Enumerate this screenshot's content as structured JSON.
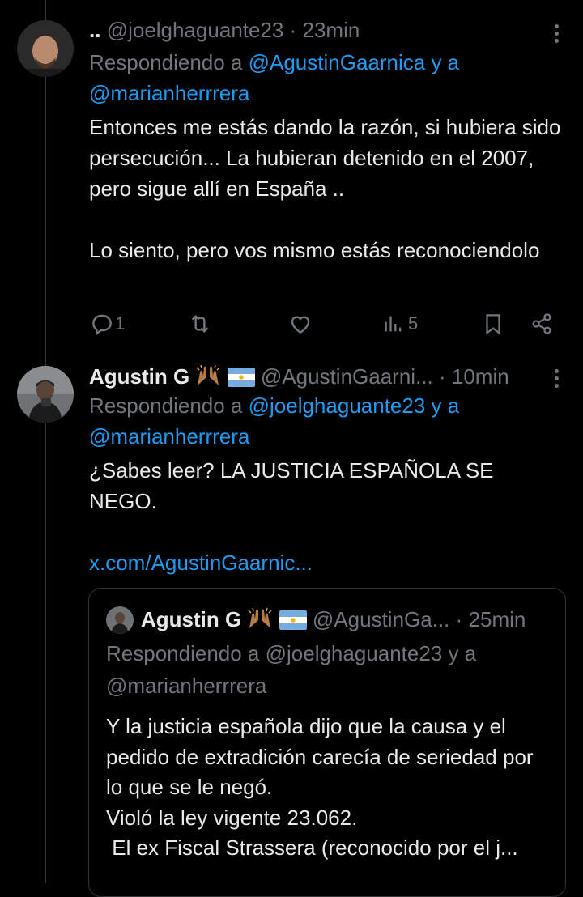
{
  "tweets": [
    {
      "display_name": "..",
      "handle": "@joelghaguante23",
      "time": "· 23min",
      "reply_prefix": "Respondiendo a ",
      "reply_link1": "@AgustinGaarnica y a",
      "reply_link2": "@marianherrrera",
      "text": "Entonces me estás dando la razón, si hubiera sido persecución... La hubieran detenido en el 2007, pero sigue allí en España ..\n\nLo siento, pero vos mismo estás reconociendolo",
      "reply_count": "1",
      "views_count": "5"
    },
    {
      "display_name": "Agustin G",
      "handle": "@AgustinGaarni...",
      "time": "· 10min",
      "reply_prefix": "Respondiendo a ",
      "reply_link1": "@joelghaguante23 y a",
      "reply_link2": "@marianherrrera",
      "text": "¿Sabes leer? LA JUSTICIA ESPAÑOLA SE NEGO.",
      "link": "x.com/AgustinGaarnic..."
    }
  ],
  "quote": {
    "display_name": "Agustin G",
    "handle": "@AgustinGa...",
    "time": "· 25min",
    "reply_line1": "Respondiendo a @joelghaguante23 y a",
    "reply_line2": "@marianherrrera",
    "text": "Y la justicia española dijo que la causa y el pedido de extradición carecía de seriedad por lo que se le negó.\nVioló la ley vigente 23.062.\n El ex Fiscal Strassera (reconocido por el j..."
  },
  "colors": {
    "accent": "#1d9bf0",
    "muted": "#71767b",
    "text": "#e7e9ea",
    "background": "#000000"
  }
}
